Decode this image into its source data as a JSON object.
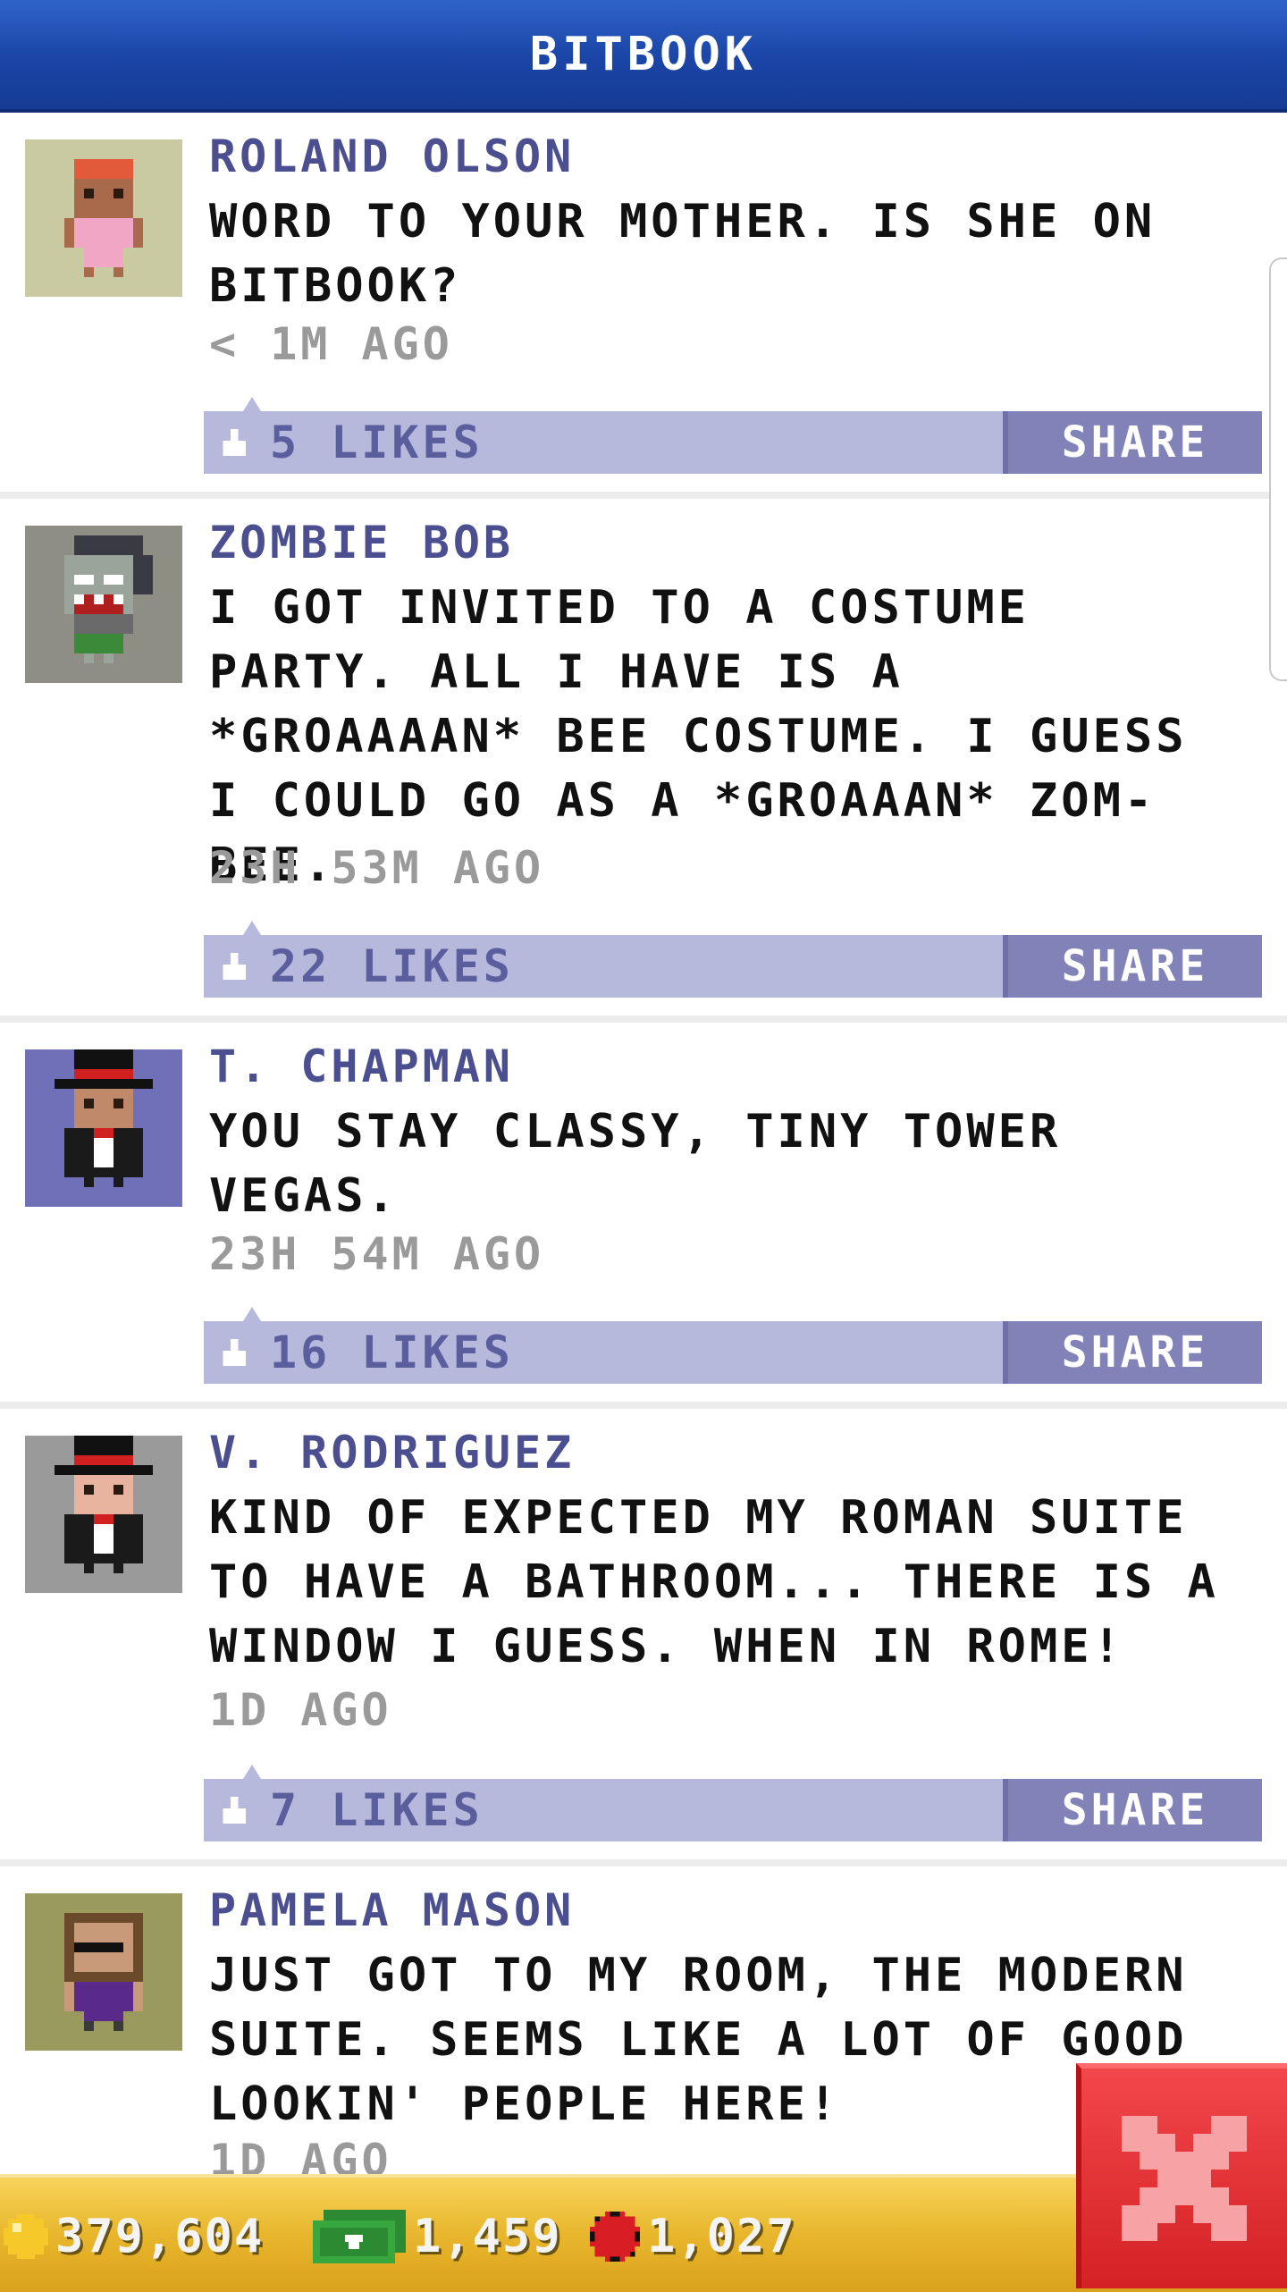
{
  "header": {
    "title": "BITBOOK"
  },
  "posts": [
    {
      "author": "ROLAND OLSON",
      "message": "WORD TO YOUR MOTHER. IS SHE ON BITBOOK?",
      "time": "< 1M AGO",
      "likes": "5 LIKES",
      "share_label": "SHARE"
    },
    {
      "author": "ZOMBIE BOB",
      "message": "I GOT INVITED TO A COSTUME PARTY. ALL I HAVE IS A *GROAAAAN* BEE COSTUME. I GUESS I COULD GO AS A *GROAAAN* ZOM-BEE.",
      "time": "23H 53M AGO",
      "likes": "22 LIKES",
      "share_label": "SHARE"
    },
    {
      "author": "T. CHAPMAN",
      "message": "YOU STAY CLASSY, TINY TOWER VEGAS.",
      "time": "23H 54M AGO",
      "likes": "16 LIKES",
      "share_label": "SHARE"
    },
    {
      "author": "V. RODRIGUEZ",
      "message": "KIND OF EXPECTED MY ROMAN SUITE TO HAVE A BATHROOM... THERE IS A WINDOW I GUESS. WHEN IN ROME!",
      "time": "1D AGO",
      "likes": "7 LIKES",
      "share_label": "SHARE"
    },
    {
      "author": "PAMELA MASON",
      "message": "JUST GOT TO MY ROOM, THE MODERN SUITE. SEEMS LIKE A LOT OF GOOD LOOKIN' PEOPLE HERE!",
      "time": "1D AGO"
    }
  ],
  "status": {
    "coins": "379,604",
    "bux": "1,459",
    "chips": "1,027"
  },
  "icons": {
    "like": "thumbs-up-icon",
    "coin": "coin-icon",
    "bux": "cash-icon",
    "chip": "poker-chip-icon",
    "close": "close-icon"
  },
  "colors": {
    "header": "#1a44a6",
    "author": "#4b4f8f",
    "like_bar": "#b6b8dc",
    "share_button": "#8082b8",
    "status_bar": "#e8b62c",
    "close_button": "#d42125"
  }
}
